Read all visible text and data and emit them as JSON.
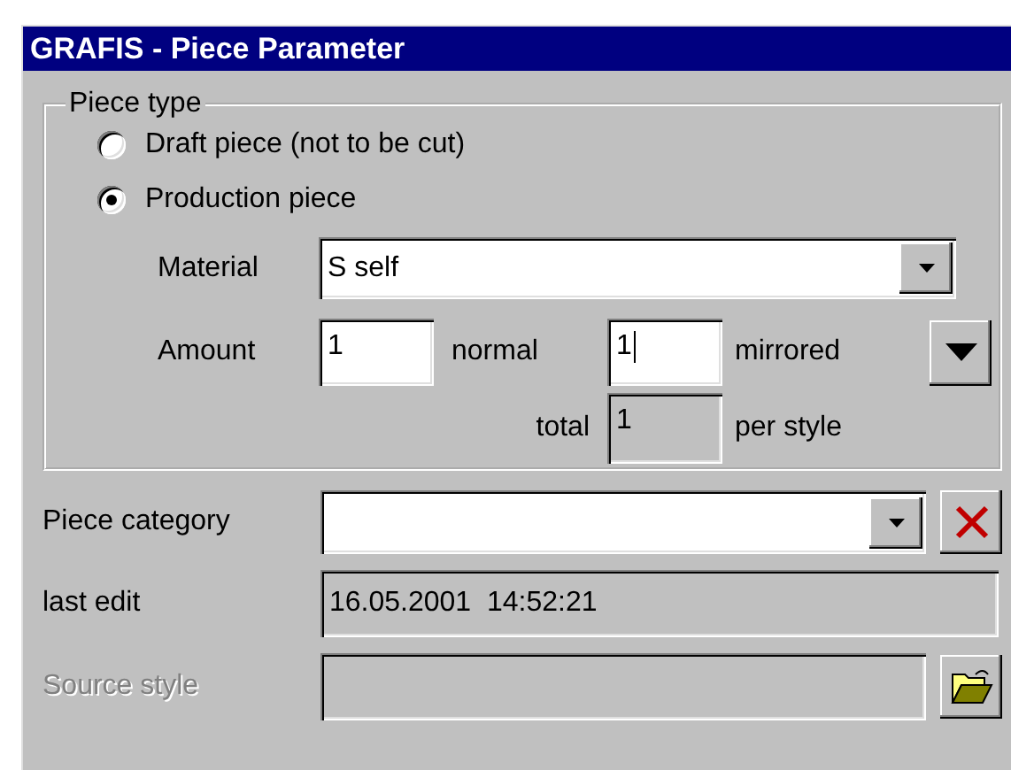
{
  "window": {
    "title": "GRAFIS - Piece Parameter"
  },
  "piece_type": {
    "legend": "Piece type",
    "options": [
      {
        "label": "Draft piece (not to be cut)",
        "selected": false
      },
      {
        "label": "Production piece",
        "selected": true
      }
    ]
  },
  "material": {
    "label": "Material",
    "value": "S self"
  },
  "amount": {
    "label": "Amount",
    "normal": {
      "value": "1",
      "label": "normal"
    },
    "mirrored": {
      "value": "1",
      "label": "mirrored",
      "focused": true
    }
  },
  "total": {
    "label": "total",
    "value": "1",
    "suffix": "per style"
  },
  "piece_category": {
    "label": "Piece category"
  },
  "last_edit": {
    "label": "last edit",
    "value": "16.05.2001  14:52:21"
  },
  "source_style": {
    "label": "Source style",
    "disabled": true
  }
}
